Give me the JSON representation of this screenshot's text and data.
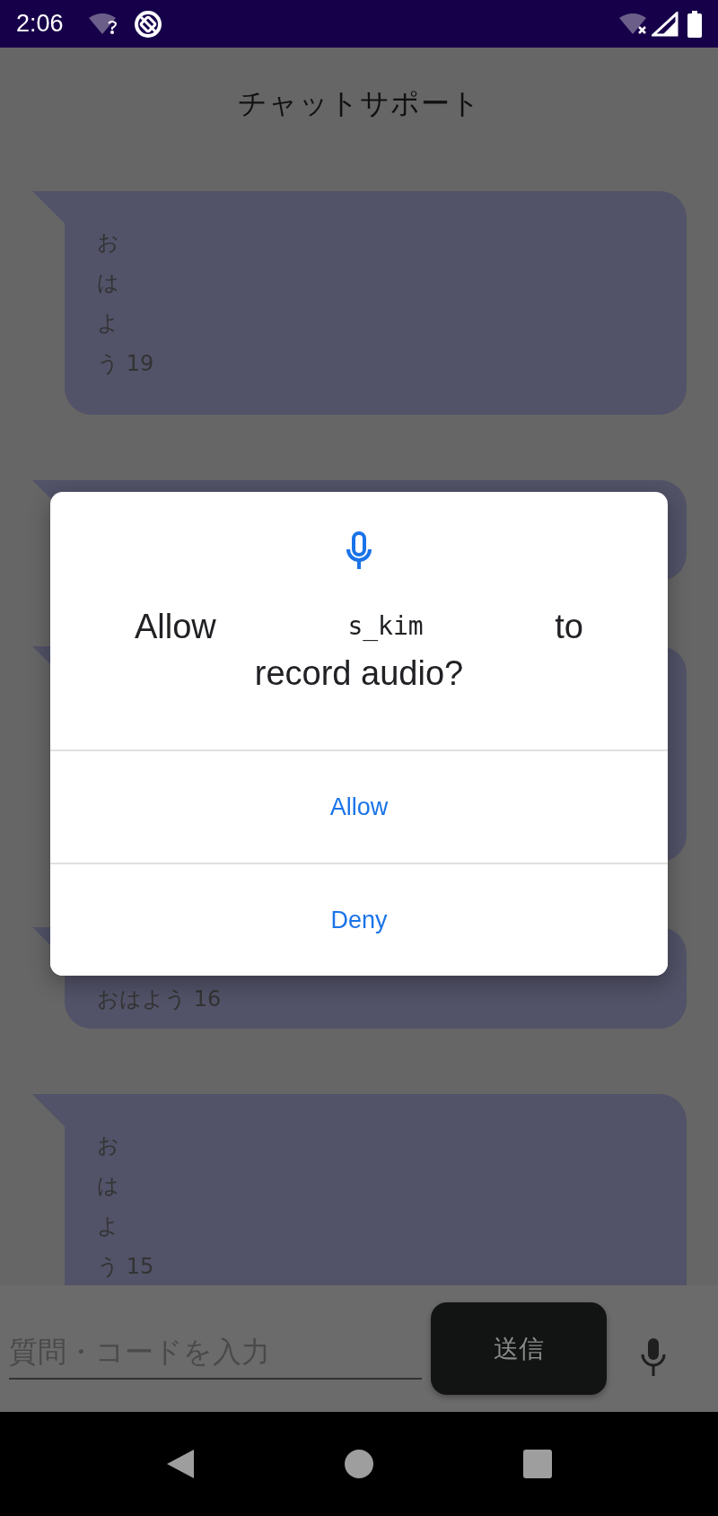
{
  "status_bar": {
    "time": "2:06"
  },
  "header": {
    "title": "チャットサポート"
  },
  "messages": [
    {
      "kind": "multiline",
      "lines": [
        "お",
        "は",
        "よ",
        "う 19"
      ]
    },
    {
      "kind": "single"
    },
    {
      "kind": "multiline"
    },
    {
      "kind": "single",
      "lines": [
        "おはよう 16"
      ]
    },
    {
      "kind": "multiline",
      "lines": [
        "お",
        "は",
        "よ",
        "う 15"
      ]
    }
  ],
  "composer": {
    "placeholder": "質問・コードを入力",
    "send_label": "送信"
  },
  "dialog": {
    "title_parts": [
      "Allow",
      "s_kim",
      "to"
    ],
    "title_line2": "record audio?",
    "buttons": [
      "Allow",
      "Deny"
    ]
  }
}
